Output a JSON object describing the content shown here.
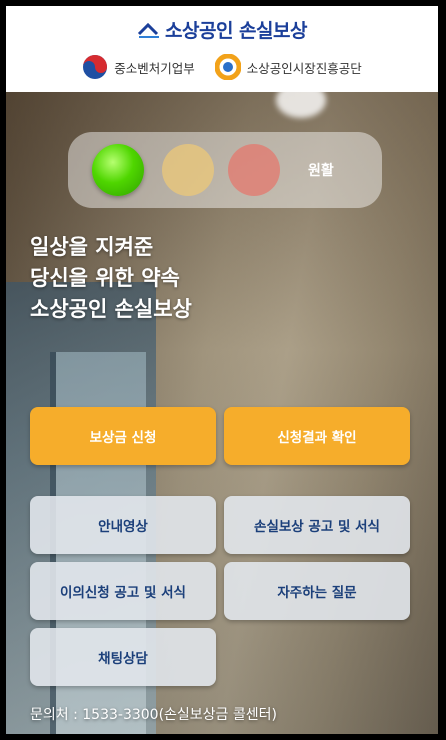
{
  "header": {
    "brand_title": "소상공인 손실보상",
    "orgs": [
      {
        "name": "중소벤처기업부",
        "logo": "taegeuk-logo-icon"
      },
      {
        "name": "소상공인시장진흥공단",
        "logo": "semas-logo-icon"
      }
    ]
  },
  "status": {
    "label": "원활",
    "active_light": "green"
  },
  "slogan": {
    "lines": [
      "일상을 지켜준",
      "당신을 위한 약속",
      "소상공인 손실보상"
    ]
  },
  "buttons": {
    "apply": "보상금 신청",
    "result": "신청결과 확인",
    "guide_video": "안내영상",
    "loss_notice": "손실보상 공고 및 서식",
    "objection_notice": "이의신청 공고 및 서식",
    "faq": "자주하는 질문",
    "chat": "채팅상담"
  },
  "contact": "문의처 : 1533-3300(손실보상금 콜센터)",
  "colors": {
    "brand_blue": "#1b3f9a",
    "primary_orange": "#f6ad2b",
    "status_green": "#4fd600"
  }
}
